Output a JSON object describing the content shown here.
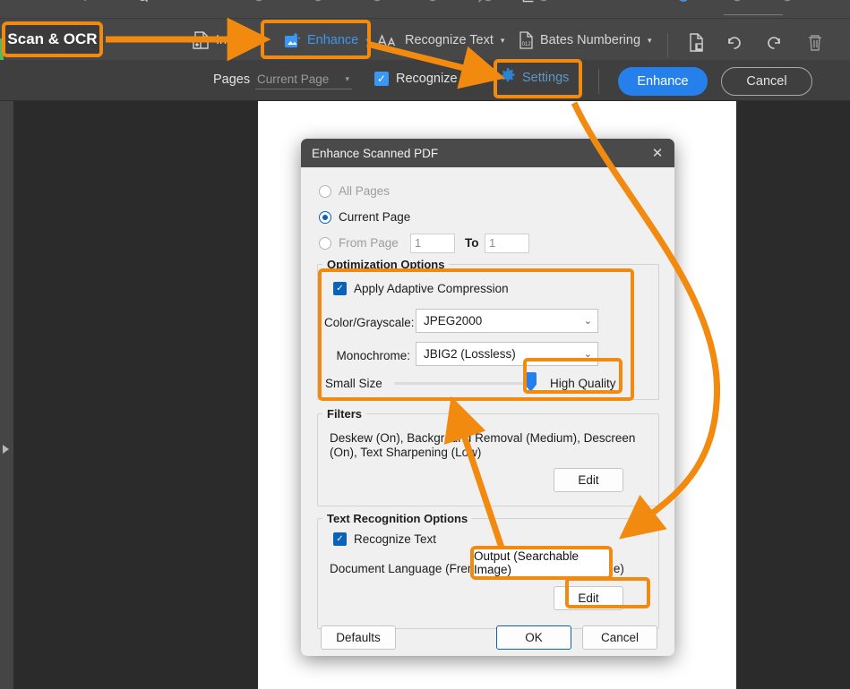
{
  "app": {
    "toolbar_strip_icons": [
      "pointer-icon",
      "move-icon",
      "zoom-icon",
      "list-icon",
      "circle-icon-1",
      "circle-icon-2",
      "circle-icon-3",
      "circle-icon-4",
      "circle-icon-5",
      "circle-icon-6",
      "comment-icon",
      "crop-icon",
      "stamp-icon",
      "circle-icon-7",
      "circle-icon-8",
      "circle-icon-9",
      "download-icon"
    ]
  },
  "toolbar": {
    "items": [
      {
        "label": "Insert",
        "icon": "insert-page-icon",
        "caret": "▾",
        "active": false
      },
      {
        "label": "Enhance",
        "icon": "enhance-image-icon",
        "caret": "▾",
        "active": true
      },
      {
        "label": "Recognize Text",
        "icon": "recognize-text-icon",
        "caret": "▾",
        "active": false
      },
      {
        "label": "Bates Numbering",
        "icon": "bates-numbering-icon",
        "caret": "▾",
        "active": false
      }
    ],
    "icon_buttons": [
      {
        "name": "scan-page-icon"
      },
      {
        "name": "rotate-counterclockwise-icon"
      },
      {
        "name": "rotate-clockwise-icon"
      },
      {
        "name": "delete-trash-icon"
      }
    ]
  },
  "optionsbar": {
    "pages_label": "Pages",
    "pages_value": "Current Page",
    "pages_caret": "▾",
    "recognize_text_label": "Recognize Text",
    "recognize_text_checked": true,
    "checkmark": "✓",
    "settings_label": "Settings",
    "settings_icon": "gear-icon",
    "enhance_button": "Enhance",
    "cancel_button": "Cancel"
  },
  "dialog": {
    "title": "Enhance Scanned PDF",
    "close_icon": "✕",
    "page_range": {
      "all_pages": {
        "label": "All Pages",
        "selected": false,
        "enabled": false
      },
      "current_page": {
        "label": "Current Page",
        "selected": true,
        "enabled": true
      },
      "from_page": {
        "label": "From Page",
        "selected": false,
        "enabled": false
      },
      "from_value": "1",
      "to_label": "To",
      "to_value": "1"
    },
    "optimization": {
      "group_title": "Optimization Options",
      "adaptive_compression_label": "Apply Adaptive Compression",
      "adaptive_compression_checked": true,
      "checkmark": "✓",
      "color_grayscale_label": "Color/Grayscale:",
      "color_grayscale_value": "JPEG2000",
      "monochrome_label": "Monochrome:",
      "monochrome_value": "JBIG2 (Lossless)",
      "chevron": "⌄",
      "slider_min_label": "Small Size",
      "slider_max_label": "High Quality",
      "slider_position_percent": 100
    },
    "filters": {
      "group_title": "Filters",
      "summary": "Deskew (On), Background Removal (Medium), Descreen (On), Text Sharpening (Low)",
      "edit_button": "Edit"
    },
    "text_recognition": {
      "group_title": "Text Recognition Options",
      "recognize_text_label": "Recognize Text",
      "recognize_text_checked": true,
      "checkmark": "✓",
      "document_language": "Document Language (French)",
      "output": "Output (Searchable Image)",
      "edit_button": "Edit"
    },
    "footer": {
      "defaults_button": "Defaults",
      "ok_button": "OK",
      "cancel_button": "Cancel"
    }
  },
  "annotations": {
    "scan_ocr_label": "Scan & OCR",
    "output_callout": "Output (Searchable Image)",
    "accent_color": "#f28a0f",
    "chip_bg": "#3b3b3b"
  }
}
